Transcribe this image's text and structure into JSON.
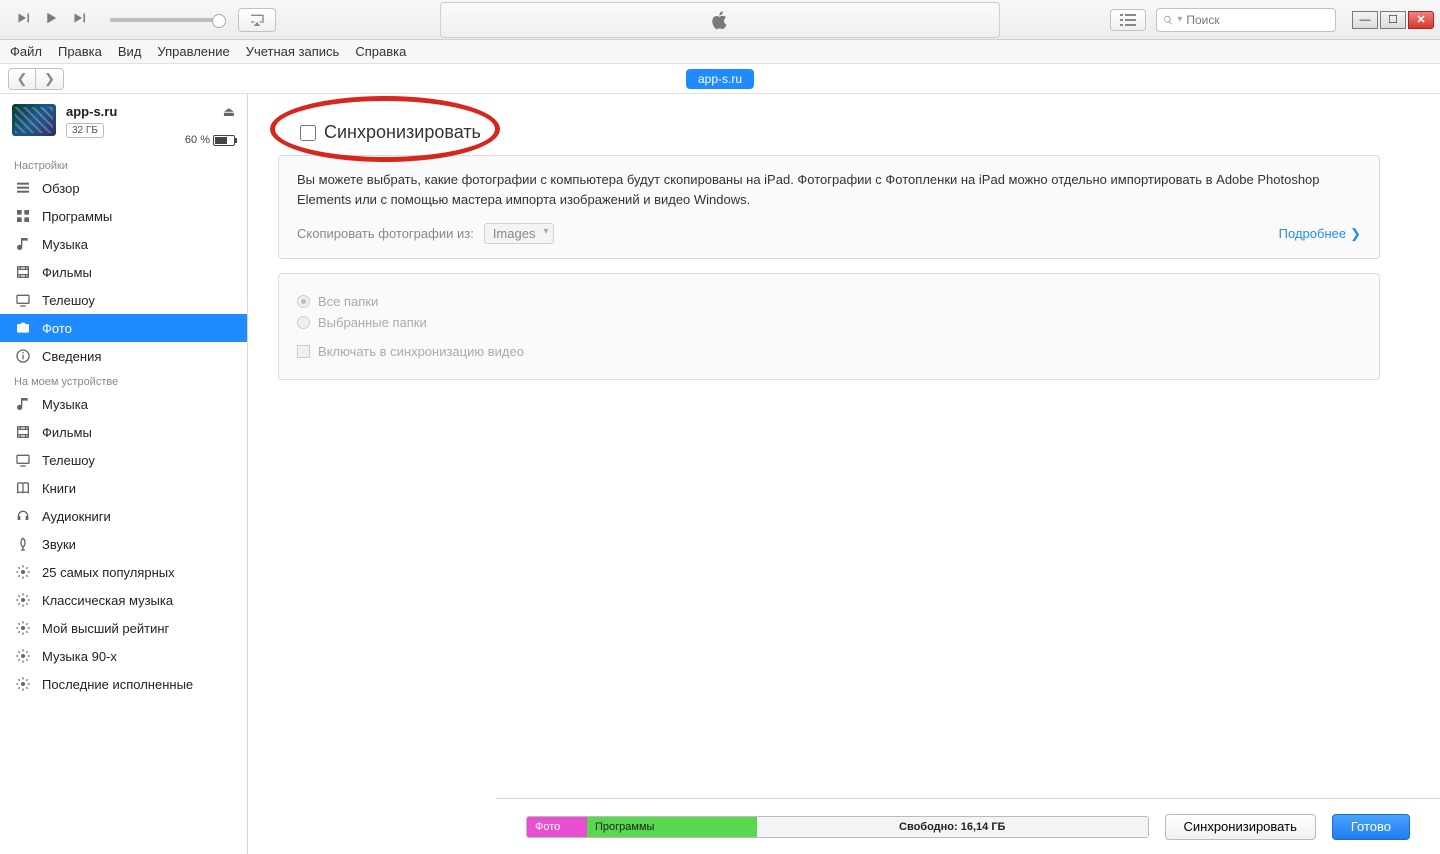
{
  "topbar": {
    "search_placeholder": "Поиск"
  },
  "menubar": [
    "Файл",
    "Правка",
    "Вид",
    "Управление",
    "Учетная запись",
    "Справка"
  ],
  "navbar": {
    "device_pill": "app-s.ru"
  },
  "device": {
    "name": "app-s.ru",
    "capacity": "32 ГБ",
    "battery_pct": "60 %"
  },
  "sidebar": {
    "settings_heading": "Настройки",
    "settings": [
      {
        "icon": "summary",
        "label": "Обзор"
      },
      {
        "icon": "apps",
        "label": "Программы"
      },
      {
        "icon": "music",
        "label": "Музыка"
      },
      {
        "icon": "movies",
        "label": "Фильмы"
      },
      {
        "icon": "tv",
        "label": "Телешоу"
      },
      {
        "icon": "photos",
        "label": "Фото",
        "active": true
      },
      {
        "icon": "info",
        "label": "Сведения"
      }
    ],
    "ondevice_heading": "На моем устройстве",
    "ondevice": [
      {
        "icon": "music",
        "label": "Музыка"
      },
      {
        "icon": "movies",
        "label": "Фильмы"
      },
      {
        "icon": "tv",
        "label": "Телешоу"
      },
      {
        "icon": "books",
        "label": "Книги"
      },
      {
        "icon": "audiobooks",
        "label": "Аудиокниги"
      },
      {
        "icon": "tones",
        "label": "Звуки"
      },
      {
        "icon": "gear",
        "label": "25 самых популярных"
      },
      {
        "icon": "gear",
        "label": "Классическая музыка"
      },
      {
        "icon": "gear",
        "label": "Мой высший рейтинг"
      },
      {
        "icon": "gear",
        "label": "Музыка 90-х"
      },
      {
        "icon": "gear",
        "label": "Последние исполненные"
      }
    ]
  },
  "content": {
    "sync_label": "Синхронизировать",
    "desc": "Вы можете выбрать, какие фотографии с компьютера будут скопированы на iPad. Фотографии с Фотопленки на iPad можно отдельно импортировать в Adobe Photoshop Elements или с помощью мастера импорта изображений и видео Windows.",
    "copy_from_label": "Скопировать фотографии из:",
    "copy_from_value": "Images",
    "more_link": "Подробнее",
    "opt_all": "Все папки",
    "opt_selected": "Выбранные папки",
    "opt_video": "Включать в синхронизацию видео"
  },
  "footer": {
    "seg_photo": "Фото",
    "seg_apps": "Программы",
    "seg_free": "Свободно: 16,14 ГБ",
    "sync_btn": "Синхронизировать",
    "done_btn": "Готово"
  }
}
